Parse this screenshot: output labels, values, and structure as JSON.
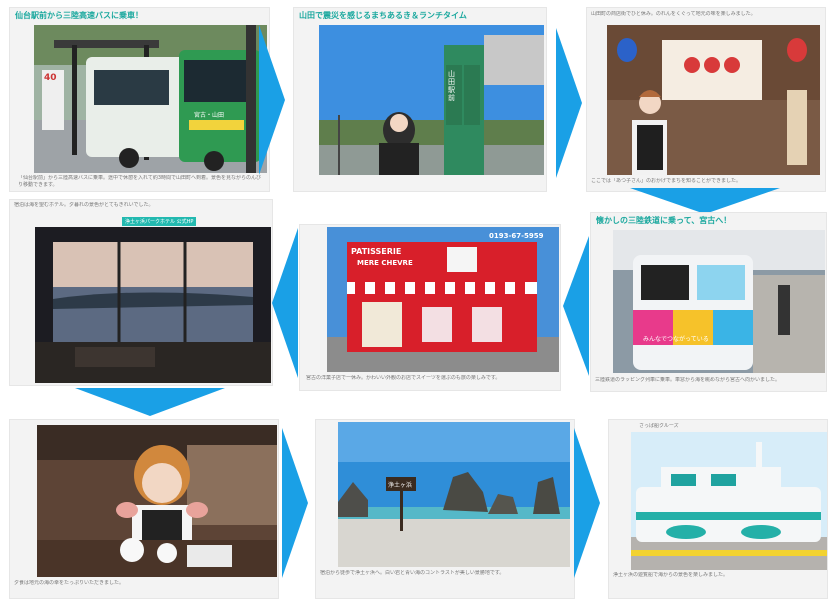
{
  "panels": [
    {
      "title": "仙台駅前から三陸高速バスに乗車！",
      "caption": "「仙台駅前」から三陸高速バスに乗車。途中で休憩を入れて約3時間で山田町へ到着。景色を見ながらのんびり移動できます。",
      "sign_text": "40",
      "bus_text": "宮古・山田"
    },
    {
      "title": "山田で震災を感じるまちあるき＆ランチタイム",
      "station_sign": "山田駅前"
    },
    {
      "title": "",
      "caption_top": "山田町の商店街でひと休み。のれんをくぐって地元の味を楽しみました。",
      "caption_bottom": "ここでは「あつ子さん」のおかげでまちを知ることができました。"
    },
    {
      "title": "懐かしの三陸鉄道に乗って、宮古へ！",
      "caption": "三陸鉄道のラッピング列車に乗車。車窓から海を眺めながら宮古へ向かいました。",
      "train_text": "みんなでつながっている"
    },
    {
      "title": "",
      "shop_name_1": "PATISSERIE",
      "shop_name_2": "MERE CHEVRE",
      "shop_tel": "0193-67-5959",
      "caption": "宮古の洋菓子店で一休み。かわいい外観のお店でスイーツを選ぶのも旅の楽しみです。"
    },
    {
      "title": "",
      "caption_top": "宿泊は海を望むホテル。夕暮れの景色がとてもきれいでした。",
      "badge": "浄土ヶ浜パークホテル 公式HP"
    },
    {
      "title": "",
      "caption": "夕食は地元の海の幸をたっぷりいただきました。"
    },
    {
      "title": "",
      "caption": "宿泊から徒歩で浄土ヶ浜へ。白い岩と青い海のコントラストが美しい景勝地です。",
      "sign_text": "浄土ヶ浜"
    },
    {
      "title": "",
      "caption_top": "さっぱ船クルーズ",
      "caption": "浄土ヶ浜の遊覧船で海からの景色を楽しみました。"
    }
  ],
  "colors": {
    "arrow": "#1aa0e6",
    "title": "#1aa89e",
    "card": "#f3f3f3"
  }
}
